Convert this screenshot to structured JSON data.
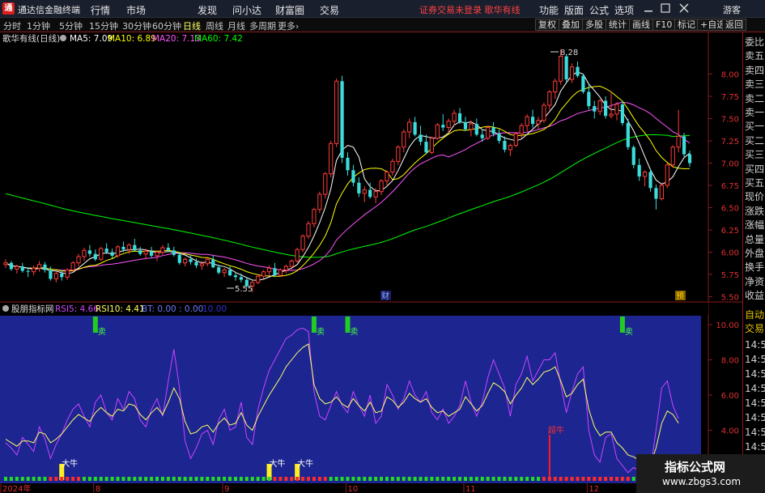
{
  "titlebar": {
    "logo_glyph": "通",
    "app_title": "通达信金融终端",
    "menus": [
      "行情",
      "市场",
      "发现",
      "问小达",
      "财富圈",
      "交易"
    ],
    "notice": "证券交易未登录 歌华有线",
    "right_menus": [
      "功能",
      "版面",
      "公式",
      "选项"
    ],
    "window_controls": [
      "minimize-icon",
      "maximize-icon",
      "close-icon"
    ],
    "guest": "游客"
  },
  "toolbar": {
    "periods": [
      "分时",
      "1分钟",
      "5分钟",
      "15分钟",
      "30分钟",
      "60分钟",
      "日线",
      "周线",
      "月线",
      "多周期",
      "更多"
    ],
    "active_period": "日线",
    "tools": [
      "复权",
      "叠加",
      "多股",
      "统计",
      "画线",
      "F10",
      "标记",
      "+自选",
      "返回"
    ]
  },
  "main_chart": {
    "stock_label": "歌华有线(日线)",
    "ma5": "MA5: 7.09",
    "ma10": "MA10: 6.89",
    "ma20": "MA20: 7.13",
    "ma60": "MA60: 7.42",
    "high_marker": "8.28",
    "low_marker": "5.55",
    "event_cai": "财",
    "event_yu": "预",
    "y_ticks": [
      "8.00",
      "7.75",
      "7.50",
      "7.25",
      "7.00",
      "6.75",
      "6.50",
      "6.25",
      "6.00",
      "5.75",
      "5.50"
    ],
    "colors": {
      "up": "#ff3c3c",
      "down": "#3cdcdc",
      "ma5": "#ffffff",
      "ma10": "#ffff00",
      "ma20": "#ff55ff",
      "ma60": "#00ff00"
    }
  },
  "indicator": {
    "name": "股朋指标网",
    "rsi5": "RSI5: 4.66",
    "rsi10": "RSI10: 4.41",
    "bt": "BT: 0.00 : 0.00",
    "extra": "10.00",
    "y_ticks": [
      "10.00",
      "8.00",
      "6.00",
      "4.00",
      "2.00"
    ],
    "sell_label": "卖",
    "bull_label": "大牛",
    "super_bull_label": "超牛",
    "colors": {
      "rsi5": "#cc44ff",
      "rsi10": "#ffff66",
      "background": "#1c2590"
    }
  },
  "xaxis": {
    "labels": [
      "2024年",
      "8",
      "9",
      "10",
      "11",
      "12",
      "1"
    ]
  },
  "right_panel": {
    "indicator_labels": [
      "委比",
      "卖五",
      "卖四",
      "卖三",
      "卖二",
      "卖一",
      "买一",
      "买二",
      "买三",
      "买四",
      "买五",
      "现价",
      "涨跌",
      "涨幅",
      "总量",
      "外盘",
      "换手",
      "净资",
      "收益"
    ],
    "mode_labels": [
      "自动",
      "交易"
    ],
    "times": [
      "14:56",
      "14:56",
      "14:56",
      "14:56",
      "14:56",
      "14:56",
      "14:56",
      "14:56",
      "14:56",
      "14:56"
    ]
  },
  "watermark": {
    "line1": "指标公式网",
    "line2": "www.zbgs3.com"
  },
  "chart_data": {
    "type": "candlestick",
    "period": "daily",
    "ohlc": [
      [
        5.86,
        5.92,
        5.82,
        5.88
      ],
      [
        5.88,
        5.9,
        5.79,
        5.81
      ],
      [
        5.81,
        5.86,
        5.76,
        5.84
      ],
      [
        5.84,
        5.88,
        5.77,
        5.79
      ],
      [
        5.79,
        5.83,
        5.72,
        5.78
      ],
      [
        5.78,
        5.85,
        5.74,
        5.82
      ],
      [
        5.82,
        5.9,
        5.78,
        5.86
      ],
      [
        5.86,
        5.89,
        5.77,
        5.8
      ],
      [
        5.8,
        5.84,
        5.68,
        5.7
      ],
      [
        5.7,
        5.78,
        5.66,
        5.76
      ],
      [
        5.76,
        5.8,
        5.68,
        5.72
      ],
      [
        5.72,
        5.82,
        5.69,
        5.8
      ],
      [
        5.8,
        5.9,
        5.78,
        5.88
      ],
      [
        5.88,
        5.98,
        5.84,
        5.95
      ],
      [
        5.95,
        6.05,
        5.9,
        6.02
      ],
      [
        6.02,
        6.08,
        5.95,
        5.98
      ],
      [
        5.98,
        6.03,
        5.9,
        5.92
      ],
      [
        5.92,
        6.06,
        5.9,
        6.04
      ],
      [
        6.04,
        6.1,
        5.98,
        6.0
      ],
      [
        6.0,
        6.04,
        5.93,
        5.96
      ],
      [
        5.96,
        6.08,
        5.94,
        6.06
      ],
      [
        6.06,
        6.12,
        6.0,
        6.03
      ],
      [
        6.03,
        6.1,
        5.98,
        6.08
      ],
      [
        6.08,
        6.15,
        6.01,
        6.02
      ],
      [
        6.02,
        6.06,
        5.96,
        5.98
      ],
      [
        5.98,
        6.04,
        5.92,
        6.01
      ],
      [
        6.01,
        6.06,
        5.94,
        5.96
      ],
      [
        5.96,
        6.02,
        5.9,
        6.0
      ],
      [
        6.0,
        6.08,
        5.97,
        6.05
      ],
      [
        6.05,
        6.1,
        6.0,
        6.02
      ],
      [
        6.02,
        6.06,
        5.95,
        5.97
      ],
      [
        5.97,
        6.0,
        5.86,
        5.88
      ],
      [
        5.88,
        5.94,
        5.84,
        5.92
      ],
      [
        5.92,
        5.97,
        5.86,
        5.89
      ],
      [
        5.89,
        5.93,
        5.82,
        5.85
      ],
      [
        5.85,
        5.9,
        5.8,
        5.87
      ],
      [
        5.87,
        5.95,
        5.84,
        5.92
      ],
      [
        5.92,
        5.96,
        5.82,
        5.83
      ],
      [
        5.83,
        5.86,
        5.75,
        5.77
      ],
      [
        5.77,
        5.82,
        5.72,
        5.8
      ],
      [
        5.8,
        5.84,
        5.73,
        5.74
      ],
      [
        5.74,
        5.78,
        5.68,
        5.72
      ],
      [
        5.72,
        5.76,
        5.66,
        5.69
      ],
      [
        5.69,
        5.72,
        5.6,
        5.62
      ],
      [
        5.62,
        5.68,
        5.55,
        5.66
      ],
      [
        5.66,
        5.75,
        5.64,
        5.73
      ],
      [
        5.73,
        5.8,
        5.7,
        5.78
      ],
      [
        5.78,
        5.85,
        5.74,
        5.82
      ],
      [
        5.82,
        5.88,
        5.72,
        5.74
      ],
      [
        5.74,
        5.82,
        5.72,
        5.8
      ],
      [
        5.8,
        5.86,
        5.76,
        5.84
      ],
      [
        5.84,
        5.92,
        5.8,
        5.9
      ],
      [
        5.9,
        6.05,
        5.88,
        6.03
      ],
      [
        6.03,
        6.2,
        6.0,
        6.18
      ],
      [
        6.18,
        6.35,
        6.15,
        6.32
      ],
      [
        6.32,
        6.5,
        6.28,
        6.48
      ],
      [
        6.48,
        6.68,
        6.44,
        6.65
      ],
      [
        6.65,
        6.9,
        6.6,
        6.88
      ],
      [
        6.88,
        7.25,
        6.84,
        7.22
      ],
      [
        7.22,
        7.95,
        7.18,
        7.92
      ],
      [
        7.92,
        7.98,
        7.0,
        7.06
      ],
      [
        7.06,
        7.12,
        6.86,
        6.92
      ],
      [
        6.92,
        6.98,
        6.74,
        6.78
      ],
      [
        6.78,
        6.84,
        6.62,
        6.66
      ],
      [
        6.66,
        6.74,
        6.56,
        6.7
      ],
      [
        6.7,
        6.78,
        6.6,
        6.62
      ],
      [
        6.62,
        6.72,
        6.55,
        6.68
      ],
      [
        6.68,
        6.82,
        6.64,
        6.8
      ],
      [
        6.8,
        6.92,
        6.74,
        6.9
      ],
      [
        6.9,
        7.05,
        6.86,
        7.02
      ],
      [
        7.02,
        7.2,
        6.98,
        7.18
      ],
      [
        7.18,
        7.38,
        7.12,
        7.35
      ],
      [
        7.35,
        7.5,
        7.28,
        7.46
      ],
      [
        7.46,
        7.52,
        7.3,
        7.32
      ],
      [
        7.32,
        7.42,
        7.2,
        7.24
      ],
      [
        7.24,
        7.32,
        7.1,
        7.12
      ],
      [
        7.12,
        7.3,
        7.1,
        7.28
      ],
      [
        7.28,
        7.45,
        7.26,
        7.43
      ],
      [
        7.43,
        7.55,
        7.36,
        7.4
      ],
      [
        7.4,
        7.5,
        7.34,
        7.47
      ],
      [
        7.47,
        7.6,
        7.42,
        7.56
      ],
      [
        7.56,
        7.62,
        7.44,
        7.46
      ],
      [
        7.46,
        7.52,
        7.36,
        7.38
      ],
      [
        7.38,
        7.48,
        7.3,
        7.44
      ],
      [
        7.44,
        7.5,
        7.3,
        7.32
      ],
      [
        7.32,
        7.38,
        7.24,
        7.28
      ],
      [
        7.28,
        7.42,
        7.26,
        7.4
      ],
      [
        7.4,
        7.46,
        7.3,
        7.33
      ],
      [
        7.33,
        7.38,
        7.22,
        7.25
      ],
      [
        7.25,
        7.3,
        7.12,
        7.15
      ],
      [
        7.15,
        7.22,
        7.08,
        7.2
      ],
      [
        7.2,
        7.35,
        7.18,
        7.33
      ],
      [
        7.33,
        7.45,
        7.28,
        7.42
      ],
      [
        7.42,
        7.55,
        7.36,
        7.52
      ],
      [
        7.52,
        7.6,
        7.4,
        7.44
      ],
      [
        7.44,
        7.52,
        7.38,
        7.48
      ],
      [
        7.48,
        7.68,
        7.45,
        7.65
      ],
      [
        7.65,
        7.82,
        7.6,
        7.8
      ],
      [
        7.8,
        7.95,
        7.72,
        7.92
      ],
      [
        7.92,
        8.28,
        7.88,
        8.2
      ],
      [
        8.2,
        8.22,
        7.9,
        7.94
      ],
      [
        7.94,
        8.12,
        7.9,
        8.08
      ],
      [
        8.08,
        8.14,
        7.96,
        7.98
      ],
      [
        7.98,
        8.0,
        7.78,
        7.8
      ],
      [
        7.8,
        7.88,
        7.6,
        7.64
      ],
      [
        7.64,
        7.7,
        7.5,
        7.58
      ],
      [
        7.58,
        7.72,
        7.54,
        7.7
      ],
      [
        7.7,
        7.75,
        7.5,
        7.53
      ],
      [
        7.53,
        7.8,
        7.5,
        7.55
      ],
      [
        7.55,
        7.68,
        7.48,
        7.66
      ],
      [
        7.66,
        7.7,
        7.42,
        7.45
      ],
      [
        7.45,
        7.5,
        7.15,
        7.18
      ],
      [
        7.18,
        7.2,
        6.94,
        6.98
      ],
      [
        6.98,
        7.05,
        6.8,
        6.85
      ],
      [
        6.85,
        6.92,
        6.74,
        6.9
      ],
      [
        6.9,
        6.94,
        6.68,
        6.72
      ],
      [
        6.72,
        6.76,
        6.48,
        6.6
      ],
      [
        6.6,
        6.78,
        6.58,
        6.75
      ],
      [
        6.75,
        7.0,
        6.72,
        6.98
      ],
      [
        6.98,
        7.2,
        6.95,
        7.18
      ],
      [
        7.18,
        7.6,
        7.12,
        7.3
      ],
      [
        7.3,
        7.34,
        7.06,
        7.1
      ],
      [
        7.1,
        7.14,
        6.96,
        7.0
      ]
    ],
    "rsi5": [
      3.3,
      3.0,
      2.6,
      3.6,
      3.2,
      2.8,
      4.2,
      3.5,
      2.4,
      3.2,
      3.8,
      4.6,
      5.2,
      5.5,
      4.8,
      4.2,
      5.6,
      6.0,
      5.0,
      4.6,
      5.8,
      5.2,
      6.2,
      5.8,
      4.6,
      4.2,
      5.2,
      5.8,
      4.8,
      6.8,
      8.6,
      6.4,
      3.4,
      2.4,
      3.0,
      3.8,
      4.0,
      3.2,
      4.6,
      5.2,
      4.0,
      4.2,
      5.6,
      3.6,
      3.2,
      5.2,
      6.4,
      7.4,
      8.0,
      8.6,
      9.2,
      9.4,
      9.7,
      9.8,
      9.6,
      6.2,
      4.8,
      4.6,
      5.4,
      6.2,
      5.4,
      5.0,
      6.2,
      5.4,
      4.8,
      6.0,
      4.4,
      4.8,
      6.6,
      6.0,
      5.2,
      5.8,
      6.8,
      6.0,
      5.6,
      6.2,
      5.0,
      4.6,
      5.2,
      4.4,
      4.8,
      5.4,
      6.8,
      5.6,
      4.8,
      5.6,
      7.0,
      8.0,
      7.2,
      6.4,
      4.8,
      6.6,
      7.2,
      8.2,
      6.8,
      7.4,
      8.0,
      8.0,
      8.4,
      6.6,
      5.0,
      6.2,
      7.2,
      7.6,
      4.0,
      2.6,
      2.2,
      3.6,
      3.8,
      2.4,
      2.0,
      1.6,
      1.9,
      1.7,
      1.5,
      1.8,
      4.0,
      6.4,
      6.8,
      5.4,
      4.66
    ],
    "rsi10": [
      3.5,
      3.3,
      3.1,
      3.4,
      3.4,
      3.3,
      3.9,
      3.8,
      3.3,
      3.5,
      3.8,
      4.2,
      4.6,
      4.9,
      4.7,
      4.5,
      5.0,
      5.3,
      5.0,
      4.8,
      5.2,
      5.1,
      5.5,
      5.4,
      4.9,
      4.6,
      5.0,
      5.3,
      4.9,
      5.6,
      6.4,
      5.8,
      4.5,
      3.8,
      3.9,
      4.2,
      4.3,
      3.9,
      4.4,
      4.7,
      4.3,
      4.4,
      5.0,
      4.3,
      4.0,
      4.8,
      5.4,
      6.0,
      6.5,
      7.0,
      7.6,
      8.0,
      8.4,
      8.7,
      8.9,
      6.6,
      5.8,
      5.5,
      5.6,
      5.9,
      5.5,
      5.3,
      5.8,
      5.4,
      5.1,
      5.6,
      5.0,
      5.1,
      5.9,
      5.7,
      5.3,
      5.6,
      6.1,
      5.8,
      5.6,
      5.8,
      5.3,
      5.0,
      5.1,
      4.8,
      5.0,
      5.2,
      5.9,
      5.5,
      5.1,
      5.4,
      6.1,
      6.7,
      6.5,
      6.2,
      5.5,
      6.0,
      6.4,
      7.0,
      6.6,
      6.9,
      7.3,
      7.4,
      7.6,
      6.8,
      5.9,
      6.1,
      6.6,
      6.9,
      5.2,
      4.2,
      3.7,
      3.9,
      3.9,
      3.3,
      3.0,
      2.6,
      2.5,
      2.3,
      2.1,
      2.1,
      3.0,
      4.4,
      5.1,
      4.9,
      4.41
    ],
    "sell_signal_idx": [
      16,
      55,
      61,
      110
    ],
    "bull_signal_idx": [
      10,
      47,
      52
    ],
    "super_bull_idx": [
      97
    ],
    "ylim_main": [
      5.45,
      8.45
    ],
    "ylim_indicator": [
      1.0,
      10.5
    ],
    "x_labels": [
      "2024年",
      "8",
      "9",
      "10",
      "11",
      "12",
      "1"
    ],
    "x_label_idx": [
      0,
      16,
      39,
      61,
      82,
      104,
      127
    ]
  }
}
